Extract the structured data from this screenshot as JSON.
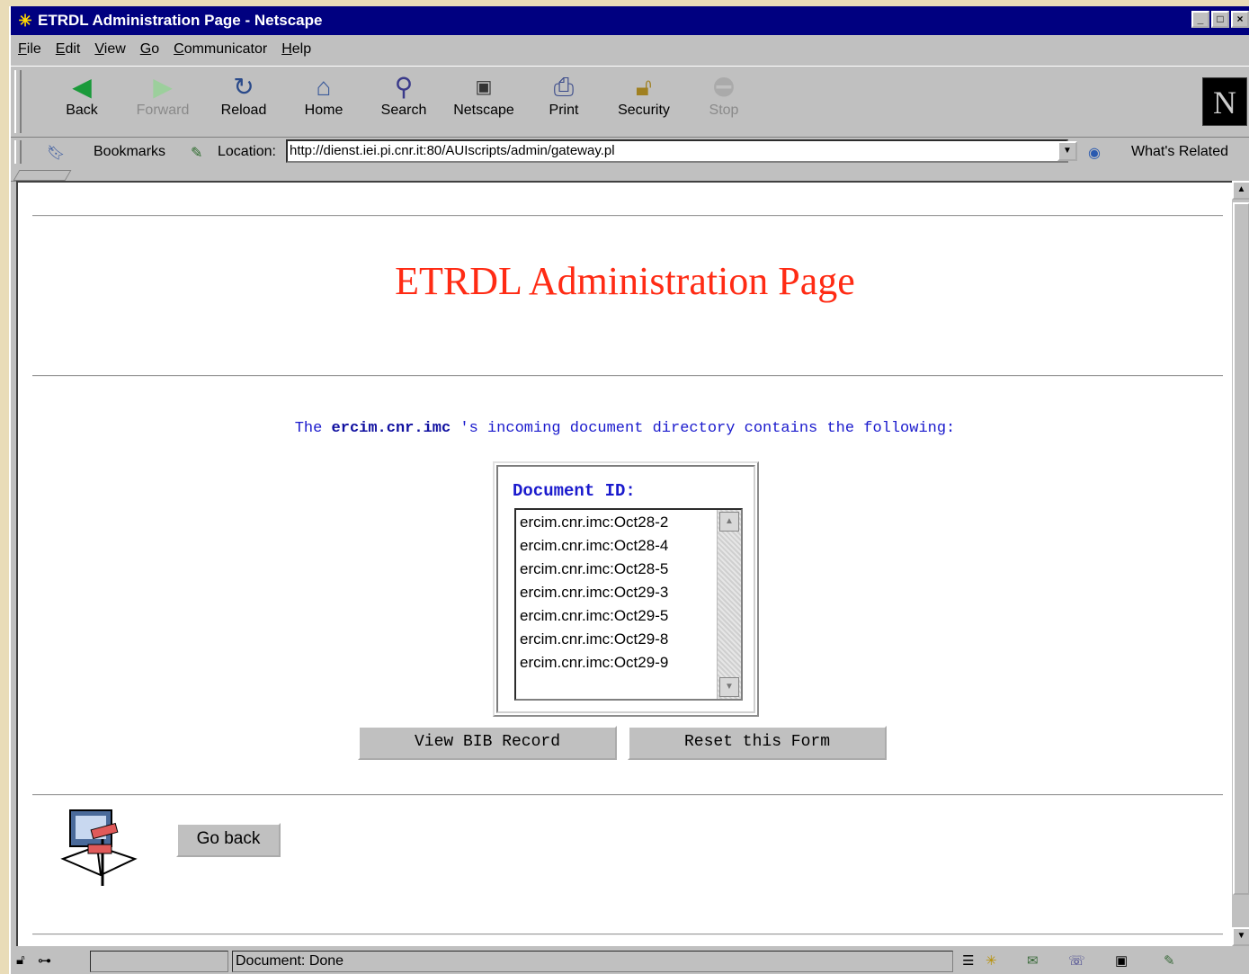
{
  "window": {
    "title": "ETRDL Administration Page - Netscape",
    "controls": [
      "_",
      "□",
      "×"
    ]
  },
  "menu": [
    "File",
    "Edit",
    "View",
    "Go",
    "Communicator",
    "Help"
  ],
  "toolbar": {
    "back": "Back",
    "forward": "Forward",
    "reload": "Reload",
    "home": "Home",
    "search": "Search",
    "netscape": "Netscape",
    "print": "Print",
    "security": "Security",
    "stop": "Stop"
  },
  "location": {
    "bookmarks_label": "Bookmarks",
    "location_label": "Location:",
    "url": "http://dienst.iei.pi.cnr.it:80/AUIscripts/admin/gateway.pl",
    "whats_related": "What's Related"
  },
  "page": {
    "heading": "ETRDL Administration Page",
    "intro_before": "The ",
    "intro_bold": "ercim.cnr.imc",
    "intro_after": " 's incoming document directory contains the following:",
    "document_id_label": "Document ID:",
    "documents": [
      "ercim.cnr.imc:Oct28-2",
      "ercim.cnr.imc:Oct28-4",
      "ercim.cnr.imc:Oct28-5",
      "ercim.cnr.imc:Oct29-3",
      "ercim.cnr.imc:Oct29-5",
      "ercim.cnr.imc:Oct29-8",
      "ercim.cnr.imc:Oct29-9"
    ],
    "view_bib_button": "View BIB Record",
    "reset_button": "Reset this Form",
    "go_back_button": "Go back"
  },
  "status": {
    "text": "Document: Done"
  },
  "colors": {
    "titlebar": "#000080",
    "heading": "#ff2b14",
    "intro_text": "#1a1acd"
  }
}
